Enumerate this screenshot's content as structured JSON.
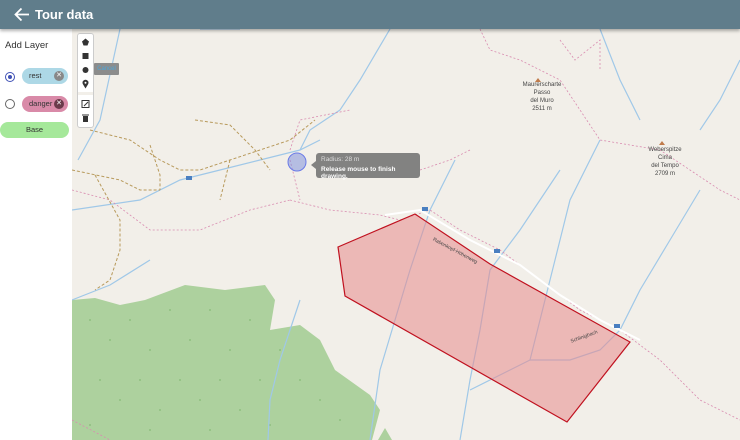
{
  "header": {
    "title": "Tour data",
    "back_icon": "arrow-left-icon"
  },
  "sidebar": {
    "add_layer_label": "Add Layer",
    "layers": [
      {
        "name": "rest",
        "selected": true,
        "color": "#add8e6"
      },
      {
        "name": "danger",
        "selected": false,
        "color": "#d98aa8"
      }
    ],
    "base_label": "Base"
  },
  "draw_toolbar": {
    "tools": [
      "polygon-icon",
      "rectangle-icon",
      "circle-icon",
      "marker-icon",
      "edit-icon",
      "trash-icon"
    ],
    "cancel_label": "Cancel"
  },
  "tooltip": {
    "radius": "Radius: 28 m",
    "hint": "Release mouse to finish drawing."
  },
  "map": {
    "peaks": [
      {
        "l1": "Maurerschartе",
        "l2": "Passo",
        "l3": "del Muro",
        "l4": "2511 m"
      },
      {
        "l1": "Weberspitze",
        "l2": "Cima",
        "l3": "del Tempo",
        "l4": "2709 m"
      }
    ],
    "path_labels": [
      "Rabenkopf-Höhenweg",
      "Schlinigbach"
    ],
    "polygon_color": "#e88a8c",
    "polygon_stroke": "#c0111f"
  }
}
